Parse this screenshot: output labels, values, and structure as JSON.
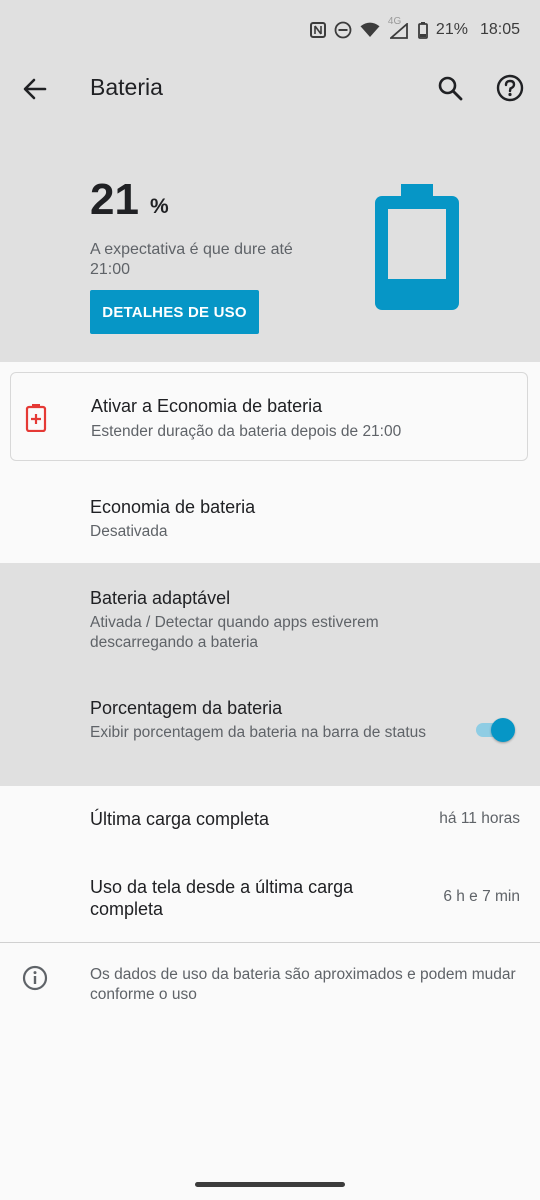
{
  "status_bar": {
    "battery_percent": "21%",
    "time": "18:05",
    "network_label": "4G",
    "icons": [
      "nfc-icon",
      "do-not-disturb-icon",
      "wifi-icon",
      "cell-signal-icon",
      "battery-icon"
    ]
  },
  "app_bar": {
    "title": "Bateria",
    "back_icon": "arrow-back-icon",
    "search_icon": "search-icon",
    "help_icon": "help-icon"
  },
  "header": {
    "percent_value": "21",
    "percent_unit": "%",
    "expectation": "A expectativa é que dure até 21:00",
    "usage_button": "DETALHES DE USO",
    "battery_level": 0.21,
    "accent_color": "#0696c6"
  },
  "saver_card": {
    "title": "Ativar a Economia de bateria",
    "subtitle": "Estender duração da bateria depois de 21:00",
    "icon": "battery-plus-icon",
    "icon_color": "#e53935"
  },
  "settings": {
    "battery_saver": {
      "title": "Economia de bateria",
      "subtitle": "Desativada"
    },
    "adaptive_battery": {
      "title": "Bateria adaptável",
      "subtitle": "Ativada / Detectar quando apps estiverem descarregando a bateria"
    },
    "battery_percentage": {
      "title": "Porcentagem da bateria",
      "subtitle": "Exibir porcentagem da bateria na barra de status",
      "enabled": true
    }
  },
  "stats": {
    "last_full_charge": {
      "label": "Última carga completa",
      "value": "há 11 horas"
    },
    "screen_usage": {
      "label": "Uso da tela desde a última carga completa",
      "value": "6 h e 7 min"
    }
  },
  "footer": {
    "info_text": "Os dados de uso da bateria são aproximados e podem mudar conforme o uso",
    "info_icon": "info-icon"
  }
}
